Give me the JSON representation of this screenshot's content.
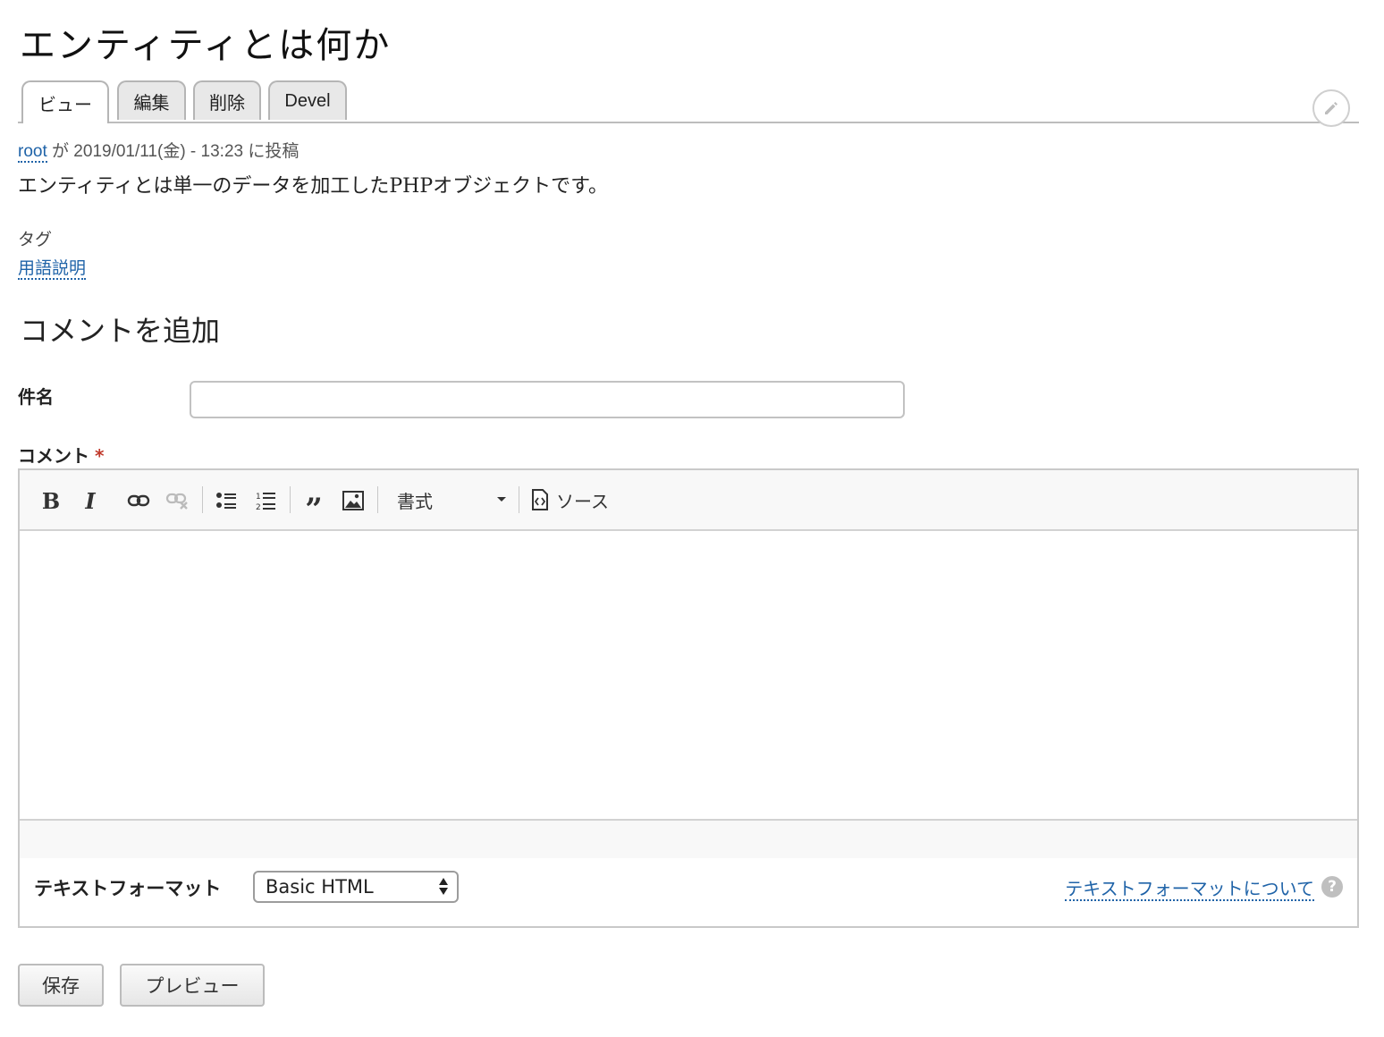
{
  "page": {
    "title": "エンティティとは何か"
  },
  "tabs": [
    {
      "label": "ビュー",
      "active": true
    },
    {
      "label": "編集"
    },
    {
      "label": "削除"
    },
    {
      "label": "Devel"
    }
  ],
  "meta": {
    "author": "root",
    "text": " が 2019/01/11(金) - 13:23 に投稿"
  },
  "body": {
    "text": "エンティティとは単一のデータを加工したPHPオブジェクトです。"
  },
  "tags": {
    "label": "タグ",
    "items": [
      "用語説明"
    ]
  },
  "comment_form": {
    "heading": "コメントを追加",
    "subject_label": "件名",
    "subject_value": "",
    "comment_label": "コメント",
    "required_mark": "*",
    "toolbar": {
      "format_label": "書式",
      "source_label": "ソース"
    },
    "text_format_label": "テキストフォーマット",
    "text_format_selected": "Basic HTML",
    "text_format_help": "テキストフォーマットについて",
    "help_icon_text": "?",
    "save_label": "保存",
    "preview_label": "プレビュー"
  },
  "colors": {
    "link": "#1f63a8",
    "required": "#c0392b"
  }
}
